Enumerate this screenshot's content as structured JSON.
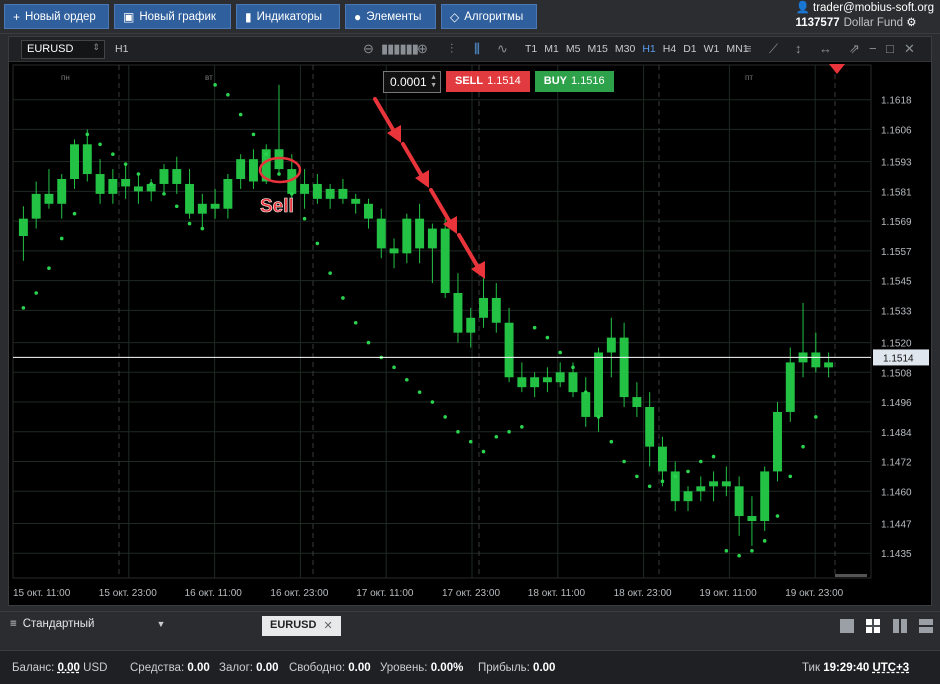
{
  "toolbar": {
    "new_order": "Новый ордер",
    "new_chart": "Новый график",
    "indicators": "Индикаторы",
    "elements": "Элементы",
    "algorithms": "Алгоритмы"
  },
  "account": {
    "user": "trader@mobius-soft.org",
    "id": "1137577",
    "fund": "Dollar Fund"
  },
  "chart": {
    "symbol": "EURUSD",
    "timeframe": "H1",
    "timeframes": [
      "T1",
      "M1",
      "M5",
      "M15",
      "M30",
      "H1",
      "H4",
      "D1",
      "W1",
      "MN1"
    ],
    "active_timeframe": "H1",
    "quantity": "0.0001",
    "sell_label": "SELL",
    "sell_price": "1.1514",
    "buy_label": "BUY",
    "buy_price": "1.1516",
    "annotation": "Sell",
    "current_price": "1.1514",
    "colors": {
      "up": "#23c244",
      "down": "#23c244",
      "sar": "#2bd44e",
      "sell": "#e13b3f",
      "buy": "#2ea24a",
      "annotation": "#e8343a"
    }
  },
  "chart_data": {
    "type": "candlestick",
    "title": "",
    "y_ticks": [
      "1.1618",
      "1.1606",
      "1.1593",
      "1.1581",
      "1.1569",
      "1.1557",
      "1.1545",
      "1.1533",
      "1.1520",
      "1.1508",
      "1.1496",
      "1.1484",
      "1.1472",
      "1.1460",
      "1.1447",
      "1.1435"
    ],
    "ylim": [
      1.1425,
      1.1632
    ],
    "x_ticks": [
      "15 окт. 11:00",
      "15 окт. 23:00",
      "16 окт. 11:00",
      "16 окт. 23:00",
      "17 окт. 11:00",
      "17 окт. 23:00",
      "18 окт. 11:00",
      "18 окт. 23:00",
      "19 окт. 11:00",
      "19 окт. 23:00"
    ],
    "day_labels": [
      "пн",
      "вт",
      "пт"
    ],
    "current_price": 1.1514,
    "candles": [
      [
        1.1563,
        1.1575,
        1.1553,
        1.157
      ],
      [
        1.157,
        1.1585,
        1.1566,
        1.158
      ],
      [
        1.158,
        1.159,
        1.1574,
        1.1576
      ],
      [
        1.1576,
        1.1588,
        1.157,
        1.1586
      ],
      [
        1.1586,
        1.1602,
        1.1582,
        1.16
      ],
      [
        1.16,
        1.1606,
        1.1585,
        1.1588
      ],
      [
        1.1588,
        1.1594,
        1.1576,
        1.158
      ],
      [
        1.158,
        1.159,
        1.1576,
        1.1586
      ],
      [
        1.1586,
        1.1592,
        1.1578,
        1.1583
      ],
      [
        1.1583,
        1.1588,
        1.1576,
        1.1581
      ],
      [
        1.1581,
        1.1586,
        1.1577,
        1.1584
      ],
      [
        1.1584,
        1.1592,
        1.158,
        1.159
      ],
      [
        1.159,
        1.1595,
        1.158,
        1.1584
      ],
      [
        1.1584,
        1.159,
        1.157,
        1.1572
      ],
      [
        1.1572,
        1.158,
        1.1566,
        1.1576
      ],
      [
        1.1576,
        1.1582,
        1.157,
        1.1574
      ],
      [
        1.1574,
        1.1588,
        1.157,
        1.1586
      ],
      [
        1.1586,
        1.1596,
        1.1582,
        1.1594
      ],
      [
        1.1594,
        1.1598,
        1.1582,
        1.1585
      ],
      [
        1.1585,
        1.16,
        1.1584,
        1.1598
      ],
      [
        1.1598,
        1.1624,
        1.1588,
        1.159
      ],
      [
        1.159,
        1.1596,
        1.1578,
        1.158
      ],
      [
        1.158,
        1.159,
        1.1574,
        1.1584
      ],
      [
        1.1584,
        1.1588,
        1.1576,
        1.1578
      ],
      [
        1.1578,
        1.1584,
        1.1574,
        1.1582
      ],
      [
        1.1582,
        1.1586,
        1.1576,
        1.1578
      ],
      [
        1.1578,
        1.158,
        1.1572,
        1.1576
      ],
      [
        1.1576,
        1.1578,
        1.1566,
        1.157
      ],
      [
        1.157,
        1.1574,
        1.1554,
        1.1558
      ],
      [
        1.1558,
        1.1562,
        1.155,
        1.1556
      ],
      [
        1.1556,
        1.1572,
        1.1552,
        1.157
      ],
      [
        1.157,
        1.1576,
        1.1552,
        1.1558
      ],
      [
        1.1558,
        1.1568,
        1.1544,
        1.1566
      ],
      [
        1.1566,
        1.157,
        1.1538,
        1.154
      ],
      [
        1.154,
        1.1548,
        1.152,
        1.1524
      ],
      [
        1.1524,
        1.1534,
        1.1518,
        1.153
      ],
      [
        1.153,
        1.1546,
        1.1526,
        1.1538
      ],
      [
        1.1538,
        1.1544,
        1.1524,
        1.1528
      ],
      [
        1.1528,
        1.1534,
        1.1504,
        1.1506
      ],
      [
        1.1506,
        1.1512,
        1.15,
        1.1502
      ],
      [
        1.1502,
        1.1508,
        1.1498,
        1.1506
      ],
      [
        1.1506,
        1.151,
        1.15,
        1.1504
      ],
      [
        1.1504,
        1.1512,
        1.1502,
        1.1508
      ],
      [
        1.1508,
        1.1512,
        1.1498,
        1.15
      ],
      [
        1.15,
        1.1506,
        1.1486,
        1.149
      ],
      [
        1.149,
        1.1518,
        1.1484,
        1.1516
      ],
      [
        1.1516,
        1.153,
        1.1506,
        1.1522
      ],
      [
        1.1522,
        1.1528,
        1.1494,
        1.1498
      ],
      [
        1.1498,
        1.1504,
        1.149,
        1.1494
      ],
      [
        1.1494,
        1.15,
        1.147,
        1.1478
      ],
      [
        1.1478,
        1.1482,
        1.1462,
        1.1468
      ],
      [
        1.1468,
        1.1472,
        1.1452,
        1.1456
      ],
      [
        1.1456,
        1.1462,
        1.1452,
        1.146
      ],
      [
        1.146,
        1.1466,
        1.1456,
        1.1462
      ],
      [
        1.1462,
        1.1468,
        1.1456,
        1.1464
      ],
      [
        1.1464,
        1.147,
        1.1458,
        1.1462
      ],
      [
        1.1462,
        1.1466,
        1.1442,
        1.145
      ],
      [
        1.145,
        1.1458,
        1.1438,
        1.1448
      ],
      [
        1.1448,
        1.147,
        1.1444,
        1.1468
      ],
      [
        1.1468,
        1.1496,
        1.1464,
        1.1492
      ],
      [
        1.1492,
        1.1518,
        1.1488,
        1.1512
      ],
      [
        1.1512,
        1.1536,
        1.1506,
        1.1516
      ],
      [
        1.1516,
        1.1524,
        1.1508,
        1.151
      ],
      [
        1.151,
        1.1516,
        1.1506,
        1.1512
      ]
    ],
    "sar": [
      1.1534,
      1.154,
      1.155,
      1.1562,
      1.1572,
      1.1604,
      1.16,
      1.1596,
      1.1592,
      1.1588,
      1.1584,
      1.158,
      1.1575,
      1.1568,
      1.1566,
      1.1624,
      1.162,
      1.1612,
      1.1604,
      1.1596,
      1.1588,
      1.158,
      1.157,
      1.156,
      1.1548,
      1.1538,
      1.1528,
      1.152,
      1.1514,
      1.151,
      1.1505,
      1.15,
      1.1496,
      1.149,
      1.1484,
      1.148,
      1.1476,
      1.1482,
      1.1484,
      1.1486,
      1.1526,
      1.1522,
      1.1516,
      1.151,
      1.15,
      1.149,
      1.148,
      1.1472,
      1.1466,
      1.1462,
      1.1464,
      1.1466,
      1.1468,
      1.1472,
      1.1474,
      1.1436,
      1.1434,
      1.1436,
      1.144,
      1.145,
      1.1466,
      1.1478,
      1.149
    ]
  },
  "tabs": {
    "template": "Стандартный",
    "chart_tab": "EURUSD"
  },
  "status": {
    "balance_label": "Баланс:",
    "balance_value": "0.00",
    "balance_currency": "USD",
    "funds_label": "Средства:",
    "funds_value": "0.00",
    "margin_label": "Залог:",
    "margin_value": "0.00",
    "free_label": "Свободно:",
    "free_value": "0.00",
    "level_label": "Уровень:",
    "level_value": "0.00%",
    "profit_label": "Прибыль:",
    "profit_value": "0.00",
    "tick_label": "Тик",
    "time": "19:29:40",
    "tz": "UTC+3"
  }
}
